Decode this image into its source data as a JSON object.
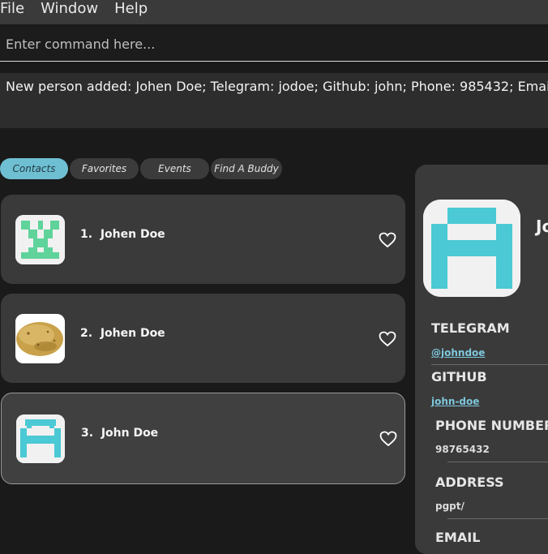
{
  "menu": [
    "File",
    "Window",
    "Help"
  ],
  "command": {
    "placeholder": "Enter command here..."
  },
  "result": {
    "text": "New person added: Johen Doe; Telegram: jodoe; Github: john; Phone: 985432; Email: jo"
  },
  "tabs": [
    {
      "label": "Contacts",
      "active": true
    },
    {
      "label": "Favorites",
      "active": false
    },
    {
      "label": "Events",
      "active": false
    },
    {
      "label": "Find A Buddy",
      "active": false
    }
  ],
  "contacts": [
    {
      "index": "1.",
      "name": "Johen Doe",
      "avatar": "green-pixel-avatar",
      "favorite": false
    },
    {
      "index": "2.",
      "name": "Johen Doe",
      "avatar": "potato-avatar",
      "favorite": false
    },
    {
      "index": "3.",
      "name": "John Doe",
      "avatar": "cyan-pixel-avatar",
      "favorite": false,
      "selected": true
    }
  ],
  "detail": {
    "name": "Jo",
    "telegram_label": "TELEGRAM",
    "telegram": "@johndoe",
    "github_label": "GITHUB",
    "github": "john-doe",
    "phone_label": "PHONE NUMBER",
    "phone": "98765432",
    "address_label": "ADDRESS",
    "address": "pgpt/",
    "email_label": "EMAIL"
  },
  "colors": {
    "accent": "#6fbfd3",
    "avatar_cyan": "#4bc9d4",
    "avatar_green": "#5fd39a",
    "link": "#7ec7dc"
  }
}
